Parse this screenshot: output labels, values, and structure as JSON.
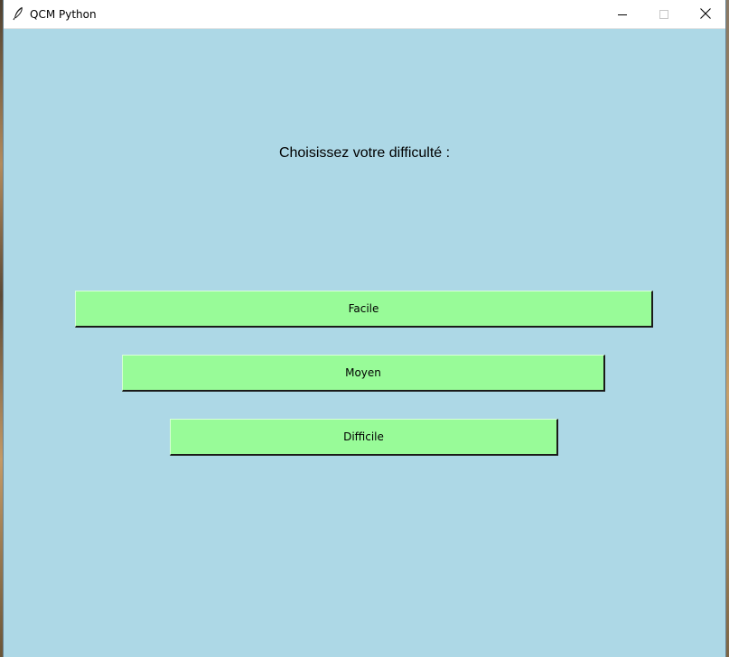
{
  "window": {
    "title": "QCM Python",
    "app_icon": "feather-icon",
    "controls": {
      "minimize_icon": "minimize-icon",
      "maximize_icon": "maximize-icon",
      "close_icon": "close-icon"
    },
    "background_color": "#add8e6"
  },
  "main": {
    "heading": "Choisissez votre difficulté :",
    "buttons": [
      {
        "label": "Facile",
        "color": "#98fb98"
      },
      {
        "label": "Moyen",
        "color": "#98fb98"
      },
      {
        "label": "Difficile",
        "color": "#98fb98"
      }
    ]
  }
}
